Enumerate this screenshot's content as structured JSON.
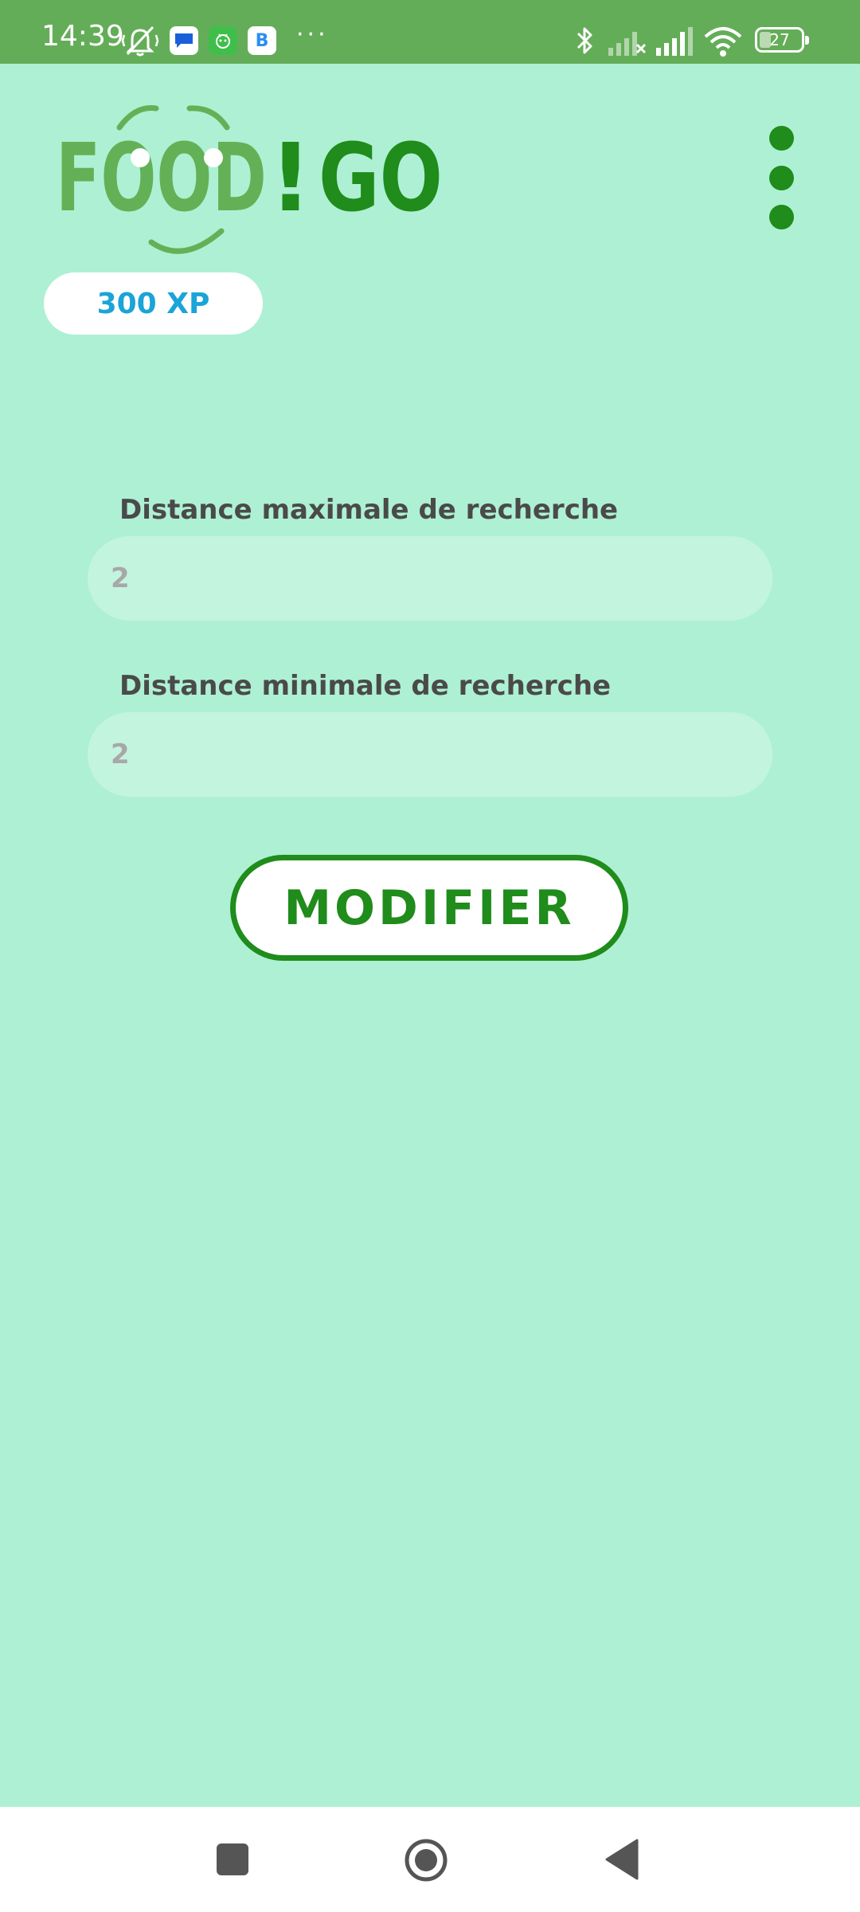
{
  "status_bar": {
    "time": "14:39",
    "battery": "27",
    "battery_level": 0.27,
    "icons": [
      "vibrate-muted-icon",
      "messages-app-icon",
      "android-app-icon",
      "b-app-icon",
      "more-notifications-icon",
      "bluetooth-icon",
      "signal-sim2-icon",
      "signal-sim1-icon",
      "wifi-icon",
      "battery-icon"
    ],
    "more": "···",
    "b_app_letter": "B"
  },
  "header": {
    "logo": {
      "food": "FOOD",
      "exclaim": "!",
      "go": "GO"
    },
    "xp": "300 XP",
    "menu_icon": "more-vertical-icon"
  },
  "form": {
    "max_distance": {
      "label": "Distance maximale de recherche",
      "placeholder": "2"
    },
    "min_distance": {
      "label": "Distance minimale de recherche",
      "placeholder": "2"
    },
    "submit_label": "MODIFIER"
  },
  "nav_bar": {
    "icons": [
      "recent-apps-icon",
      "home-icon",
      "back-icon"
    ]
  },
  "colors": {
    "background": "#aef0d3",
    "status_bar": "#64ad58",
    "brand_green": "#1f8c1b",
    "logo_light_green": "#63b156",
    "xp_text": "#1ba4d8",
    "input_bg": "#c3f4de"
  }
}
